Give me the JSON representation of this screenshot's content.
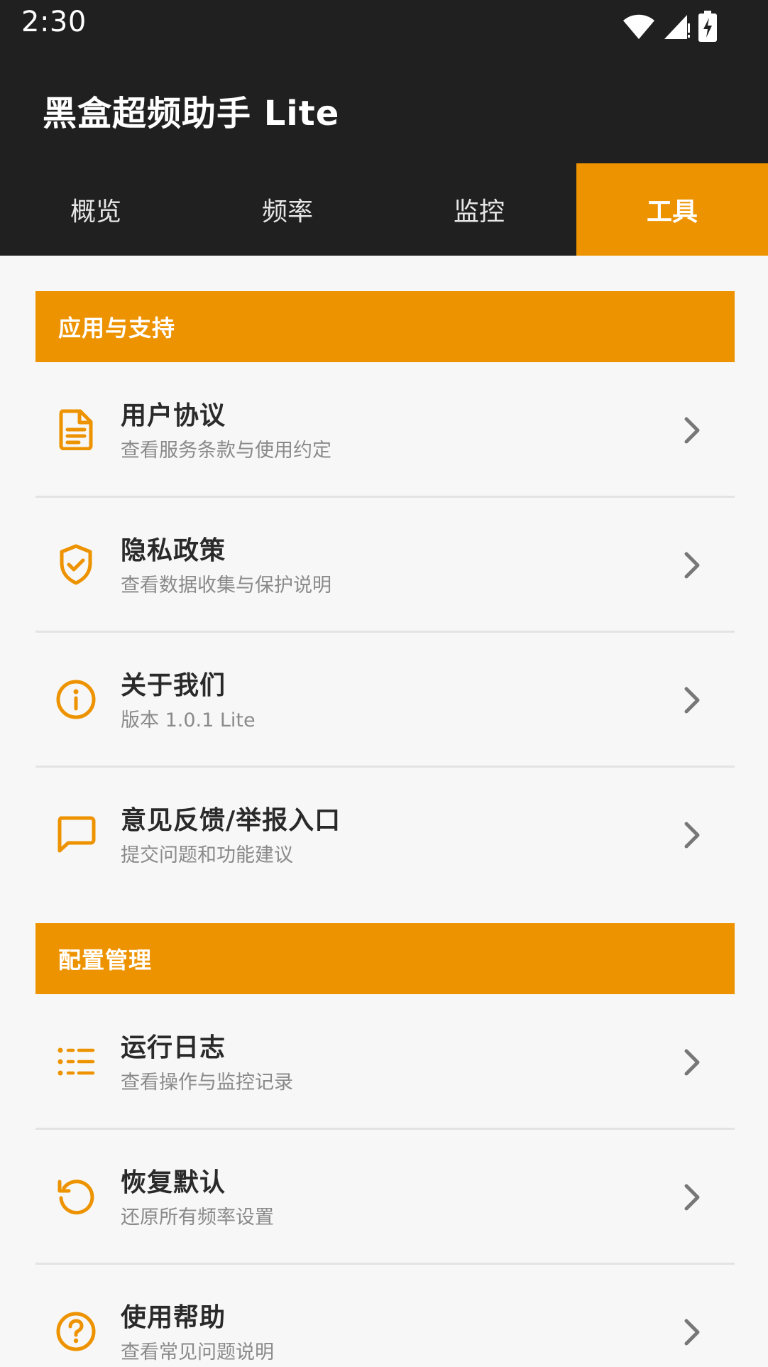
{
  "status_bar": {
    "time": "2:30",
    "icons": [
      "wifi-icon",
      "cellular-signal-icon",
      "battery-charging-icon"
    ]
  },
  "app": {
    "title": "黑盒超频助手 Lite"
  },
  "tabs": [
    {
      "label": "概览",
      "selected": false
    },
    {
      "label": "频率",
      "selected": false
    },
    {
      "label": "监控",
      "selected": false
    },
    {
      "label": "工具",
      "selected": true
    }
  ],
  "colors": {
    "accent": "#ee9300",
    "header_bg": "#202020",
    "page_bg": "#f7f7f7",
    "title_text": "#2a2a2a",
    "subtitle_text": "#8a8a8a"
  },
  "sections": [
    {
      "title": "应用与支持",
      "items": [
        {
          "icon": "document-icon",
          "title": "用户协议",
          "subtitle": "查看服务条款与使用约定"
        },
        {
          "icon": "shield-check-icon",
          "title": "隐私政策",
          "subtitle": "查看数据收集与保护说明"
        },
        {
          "icon": "info-icon",
          "title": "关于我们",
          "subtitle": "版本 1.0.1 Lite"
        },
        {
          "icon": "chat-bubble-icon",
          "title": "意见反馈/举报入口",
          "subtitle": "提交问题和功能建议"
        }
      ]
    },
    {
      "title": "配置管理",
      "items": [
        {
          "icon": "list-icon",
          "title": "运行日志",
          "subtitle": "查看操作与监控记录"
        },
        {
          "icon": "restore-icon",
          "title": "恢复默认",
          "subtitle": "还原所有频率设置"
        },
        {
          "icon": "help-icon",
          "title": "使用帮助",
          "subtitle": "查看常见问题说明"
        }
      ]
    }
  ]
}
